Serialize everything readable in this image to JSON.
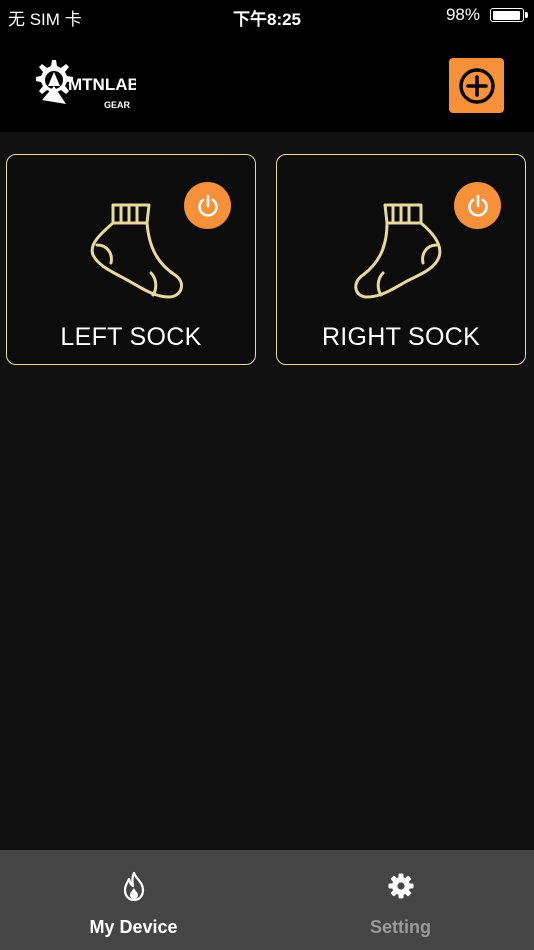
{
  "status_bar": {
    "carrier": "无 SIM 卡",
    "time": "下午8:25",
    "battery": "98%",
    "battery_level": 0.98
  },
  "header": {
    "logo_text": "MTNLAB",
    "logo_subtext": "GEAR",
    "logo_icon": "mtnlab-gear-logo",
    "add_icon": "plus-circle-icon"
  },
  "devices": [
    {
      "label": "LEFT SOCK",
      "icon": "sock-icon",
      "power_icon": "power-icon"
    },
    {
      "label": "RIGHT SOCK",
      "icon": "sock-icon",
      "power_icon": "power-icon"
    }
  ],
  "tabs": [
    {
      "label": "My Device",
      "icon": "flame-icon",
      "active": true
    },
    {
      "label": "Setting",
      "icon": "gear-icon",
      "active": false
    }
  ],
  "colors": {
    "accent": "#f6913a",
    "card_border": "#e8d99c",
    "background": "#111111",
    "tab_bar": "#454545",
    "inactive_tab": "#9a9a9a"
  }
}
